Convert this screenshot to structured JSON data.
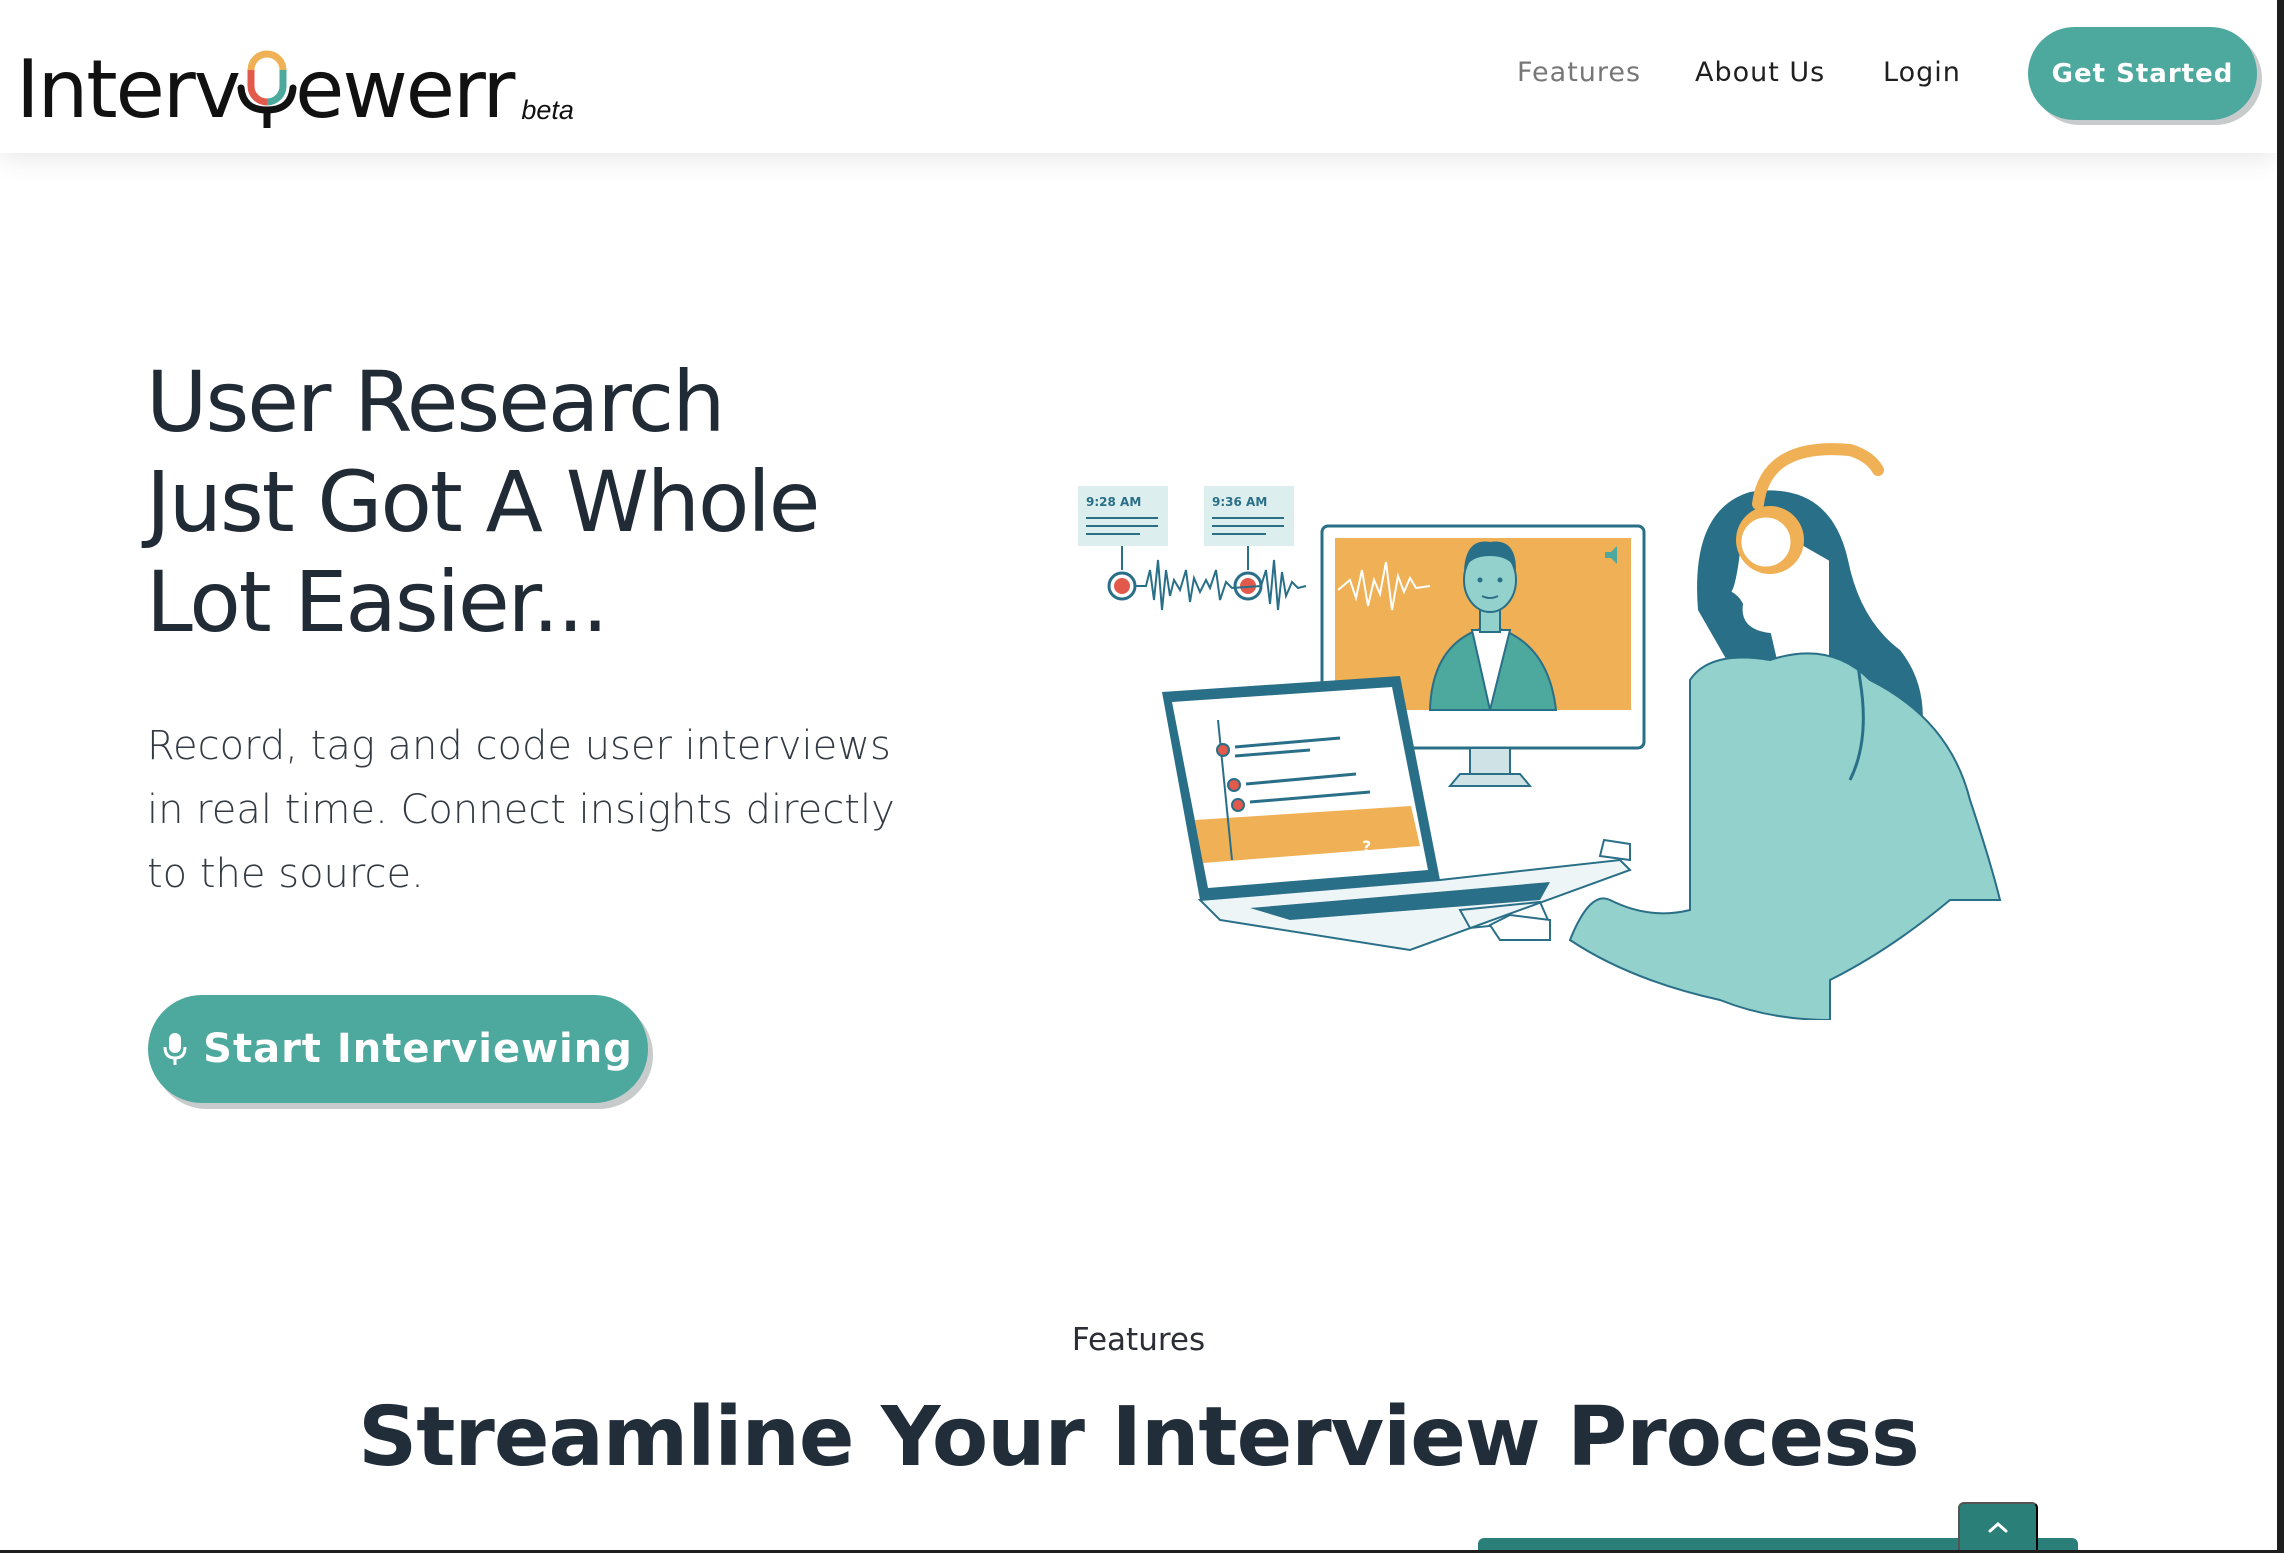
{
  "header": {
    "logo_text_prefix": "Interv",
    "logo_text_suffix": "ewerr",
    "logo_badge": "beta",
    "nav": {
      "features": "Features",
      "about": "About Us",
      "login": "Login"
    },
    "cta": "Get Started"
  },
  "hero": {
    "title_line1": "User Research",
    "title_line2": "Just Got A Whole",
    "title_line3": "Lot Easier...",
    "subtitle": "Record, tag and code user interviews in real time. Connect insights directly to the source.",
    "cta": "Start Interviewing",
    "illustration": {
      "timestamp_1": "9:28 AM",
      "timestamp_2": "9:36 AM"
    }
  },
  "features": {
    "label": "Features",
    "title": "Streamline Your Interview Process"
  },
  "colors": {
    "accent": "#4da89d",
    "accent_dark": "#2a8078",
    "orange": "#f0b055",
    "navy": "#2a6f88",
    "mint": "#93d1cc"
  }
}
